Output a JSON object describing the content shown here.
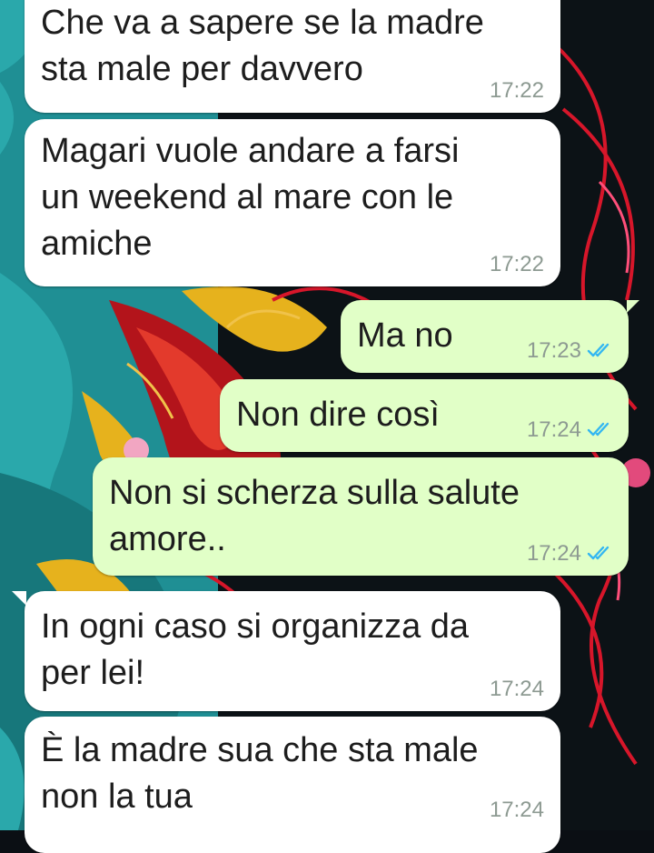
{
  "chat": {
    "messages": [
      {
        "direction": "incoming",
        "text": [
          "Che va a sapere se la madre",
          "sta male per davvero"
        ],
        "time": "17:22"
      },
      {
        "direction": "incoming",
        "text": [
          "Magari vuole andare a farsi",
          "un weekend al mare con le",
          "amiche"
        ],
        "time": "17:22"
      },
      {
        "direction": "outgoing",
        "text": [
          "Ma no"
        ],
        "time": "17:23",
        "status": "read"
      },
      {
        "direction": "outgoing",
        "text": [
          "Non dire così"
        ],
        "time": "17:24",
        "status": "read"
      },
      {
        "direction": "outgoing",
        "text": [
          "Non si scherza sulla salute",
          "amore.."
        ],
        "time": "17:24",
        "status": "read"
      },
      {
        "direction": "incoming",
        "text": [
          "In ogni caso si organizza da",
          "per lei!"
        ],
        "time": "17:24"
      },
      {
        "direction": "incoming",
        "text": [
          "È la madre sua che sta male",
          "non la tua"
        ],
        "time": "17:24"
      }
    ]
  },
  "colors": {
    "incoming_bubble": "#ffffff",
    "outgoing_bubble": "#e1ffc7",
    "read_ticks": "#34b7f1",
    "timestamp": "#8d9a92"
  },
  "icons": {
    "read_status": "double-check-icon"
  }
}
